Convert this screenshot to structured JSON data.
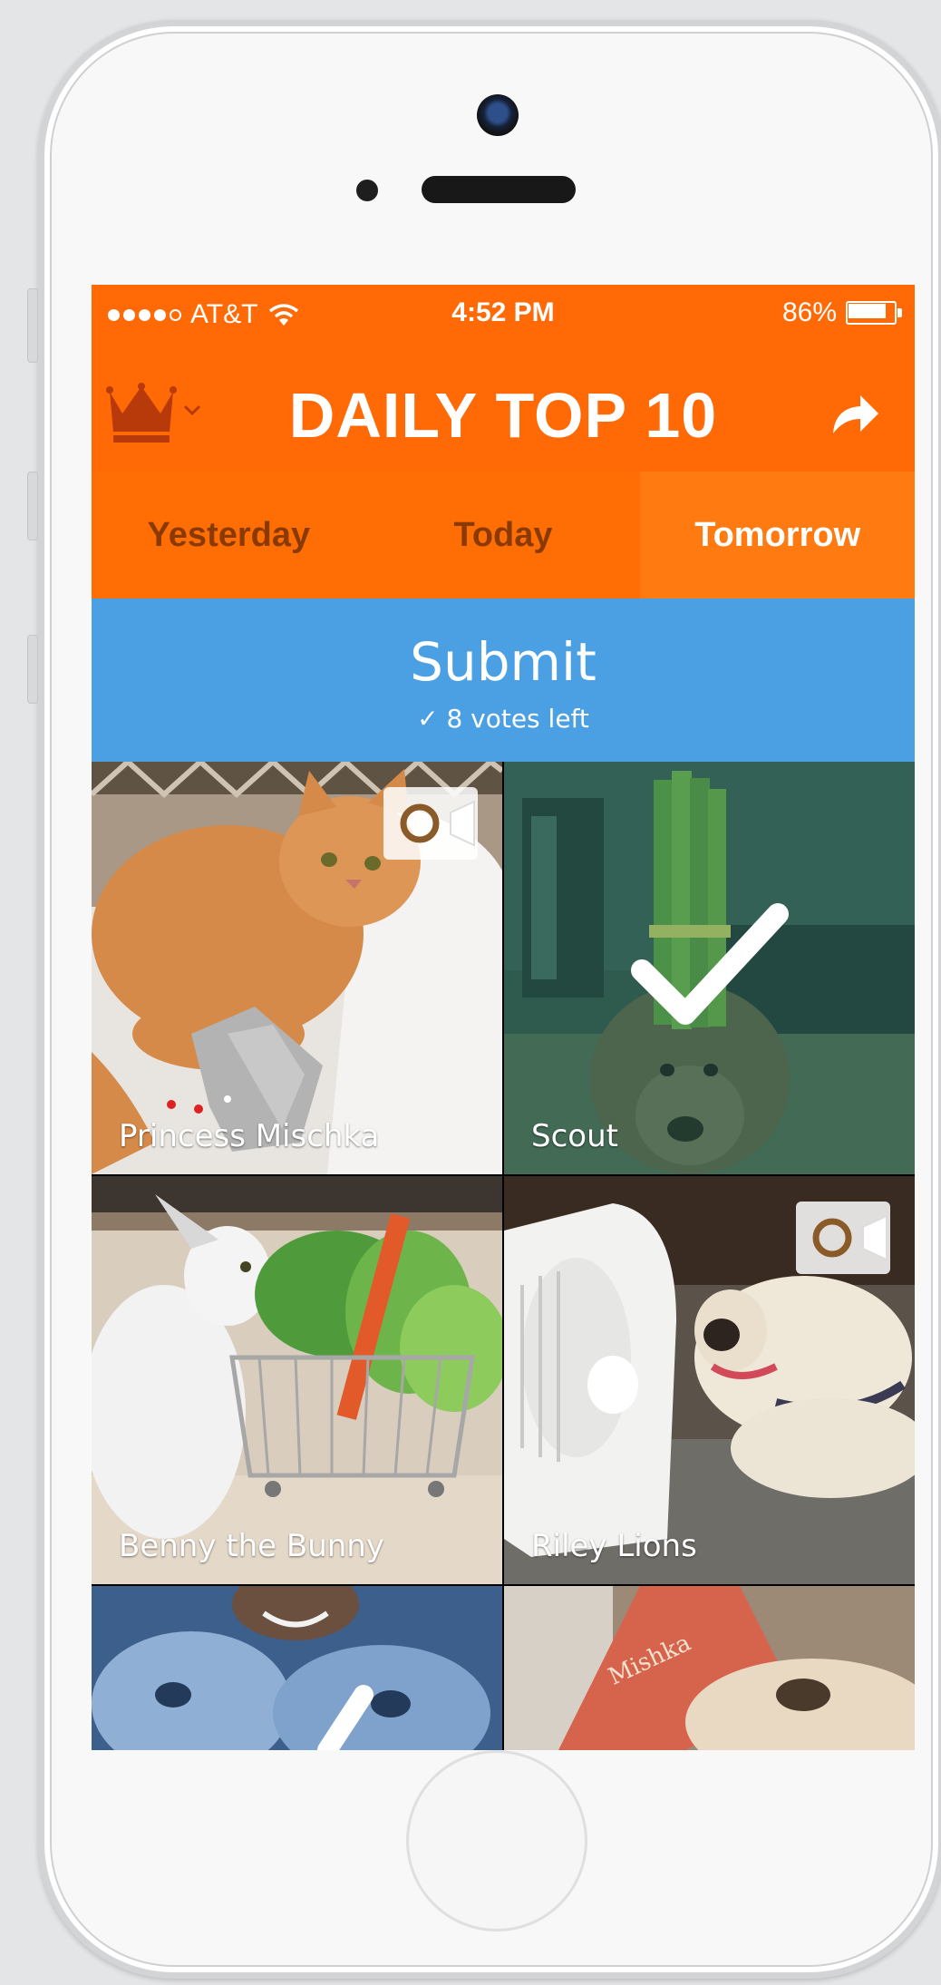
{
  "status_bar": {
    "carrier": "AT&T",
    "time": "4:52 PM",
    "battery": "86%",
    "battery_level": 0.86,
    "signal_bars": 4,
    "wifi_icon": "wifi-icon"
  },
  "header": {
    "title": "DAILY TOP 10",
    "left_icon": "crown-icon",
    "right_icon": "share-icon"
  },
  "tabs": [
    {
      "label": "Yesterday",
      "active": false
    },
    {
      "label": "Today",
      "active": false
    },
    {
      "label": "Tomorrow",
      "active": true
    }
  ],
  "submit": {
    "label": "Submit",
    "votes_left": "✓ 8 votes left"
  },
  "grid": [
    {
      "name": "Princess Mischka",
      "video": true,
      "selected": false
    },
    {
      "name": "Scout",
      "video": false,
      "selected": true
    },
    {
      "name": "Benny the Bunny",
      "video": false,
      "selected": false
    },
    {
      "name": "Riley Lions",
      "video": true,
      "selected": false
    },
    {
      "name": "",
      "video": false,
      "selected": false
    },
    {
      "name": "",
      "video": false,
      "selected": false
    }
  ],
  "colors": {
    "header_orange": "#ff6a07",
    "tab_text_inactive": "#8a3a00",
    "submit_blue": "#4aa0e3",
    "crown": "#b8390a"
  }
}
